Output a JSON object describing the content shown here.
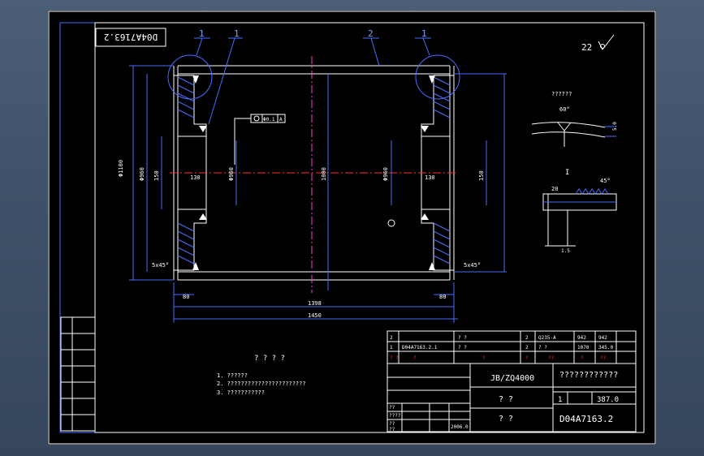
{
  "drawing": {
    "title_code_rotated": "D04A7163.2",
    "tags": {
      "t1a": "1",
      "t1b": "1",
      "t2": "2",
      "t1c": "1"
    },
    "surface_finish": "22",
    "notes_title": "? ? ? ?",
    "notes": [
      "1. ??????",
      "2. ???????????????????????",
      "3. ???????????"
    ],
    "dims": {
      "d80_l": "80",
      "d80_r": "80",
      "d1398": "1398",
      "d1450": "1450",
      "tol": "Φ0.1",
      "tol_label": "A",
      "dia_left": "Φ1100",
      "dia_in_l": "Φ960",
      "dia_in_r": "Φ960",
      "d150_l": "150",
      "d150_r": "150",
      "d130_l": "130",
      "d130_r": "130",
      "d1000": "1000",
      "dim_c_l": "5x45°",
      "dim_c_r": "5x45°"
    },
    "detail": {
      "label": "??????",
      "angle": "60°",
      "dim_side": "5.0",
      "view": "I",
      "bevel": "45°",
      "root": "20",
      "sub": "1.5"
    }
  },
  "parts_table": {
    "rows": [
      [
        "2",
        "",
        "? ?",
        "",
        "2",
        "Q235-A",
        "942",
        "942"
      ],
      [
        "1",
        "D04A7163.2.1",
        "? ?",
        "",
        "2",
        "? ?",
        "1070",
        "345.0"
      ],
      [
        "?\n?",
        "?",
        "?",
        "?",
        "?",
        "??",
        "?",
        "??"
      ]
    ]
  },
  "title_block": {
    "standard": "JB/ZQ4000",
    "name": "????????????",
    "sub": "? ?",
    "sub2": "? ?",
    "scale": "1",
    "weight": "387.0",
    "code": "D04A7163.2",
    "sign_rows": [
      "??",
      "????",
      "??",
      "??"
    ],
    "date": "2006.0"
  },
  "revision_strip": [
    "",
    "",
    "",
    "",
    "",
    "",
    ""
  ]
}
